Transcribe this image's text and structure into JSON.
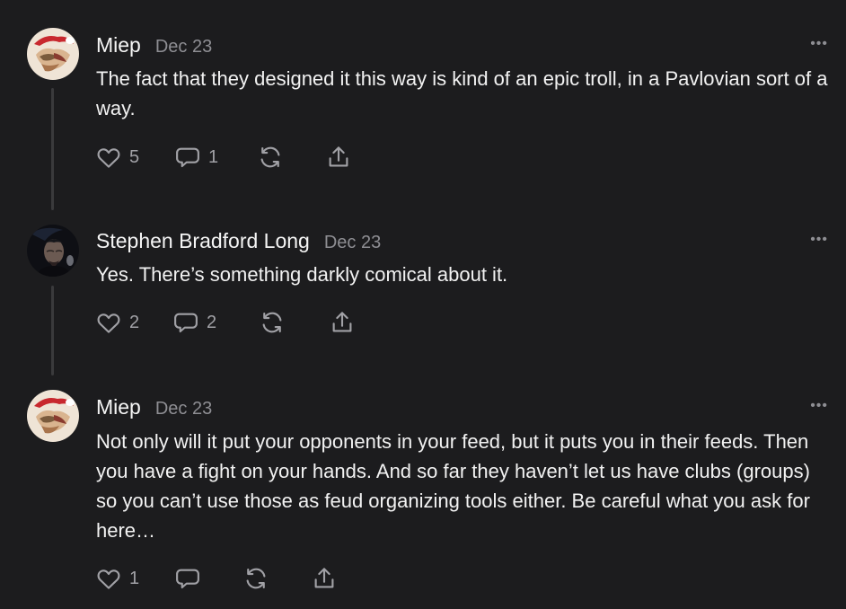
{
  "comments": [
    {
      "author": "Miep",
      "date": "Dec 23",
      "text": "The fact that they designed it this way is kind of an epic troll, in a Pavlovian sort of a way.",
      "likes": "5",
      "replies": "1",
      "more_icon": "•••"
    },
    {
      "author": "Stephen Bradford Long",
      "date": "Dec 23",
      "text": "Yes. There’s something darkly comical about it.",
      "likes": "2",
      "replies": "2",
      "more_icon": "•••"
    },
    {
      "author": "Miep",
      "date": "Dec 23",
      "text": "Not only will it put your opponents in your feed, but it puts you in their feeds. Then you have a fight on your hands. And so far they haven’t let us have clubs (groups) so you can’t use those as feud organizing tools either. Be careful what you ask for here…",
      "likes": "1",
      "replies": "",
      "more_icon": "•••"
    }
  ],
  "icons": {
    "like": "heart-icon",
    "reply": "comment-icon",
    "restack": "restack-icon",
    "share": "share-icon",
    "more": "more-options-icon"
  },
  "colors": {
    "background": "#1c1c1e",
    "text": "#f2f2f2",
    "muted": "#8e8e93",
    "thread_line": "#3a3a3c"
  }
}
